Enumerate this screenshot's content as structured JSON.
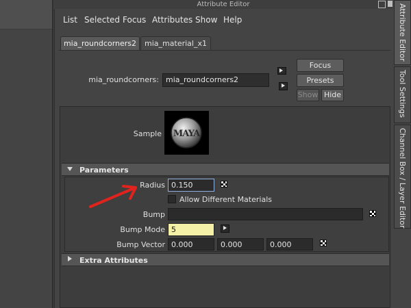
{
  "window": {
    "title": "Attribute Editor"
  },
  "menu": [
    "List",
    "Selected",
    "Focus",
    "Attributes",
    "Show",
    "Help"
  ],
  "tabs": [
    {
      "label": "mia_roundcorners2",
      "active": true
    },
    {
      "label": "mia_material_x1",
      "active": false
    }
  ],
  "node": {
    "label": "mia_roundcorners:",
    "value": "mia_roundcorners2"
  },
  "buttons": {
    "focus": "Focus",
    "presets": "Presets",
    "show": "Show",
    "hide": "Hide"
  },
  "sample": {
    "label": "Sample",
    "logo_text": "MAYA"
  },
  "parameters": {
    "header": "Parameters",
    "radius": {
      "label": "Radius",
      "value": "0.150"
    },
    "allow_diff": {
      "label": "Allow Different Materials",
      "checked": false
    },
    "bump": {
      "label": "Bump",
      "value": ""
    },
    "bump_mode": {
      "label": "Bump Mode",
      "value": "5"
    },
    "bump_vector": {
      "label": "Bump Vector",
      "x": "0.000",
      "y": "0.000",
      "z": "0.000"
    }
  },
  "extra": {
    "header": "Extra Attributes"
  },
  "side_tabs": [
    "Attribute Editor",
    "Tool Settings",
    "Channel Box / Layer Editor"
  ],
  "colors": {
    "highlight_field": "#f5f0a8",
    "arrow": "#e0231c"
  }
}
